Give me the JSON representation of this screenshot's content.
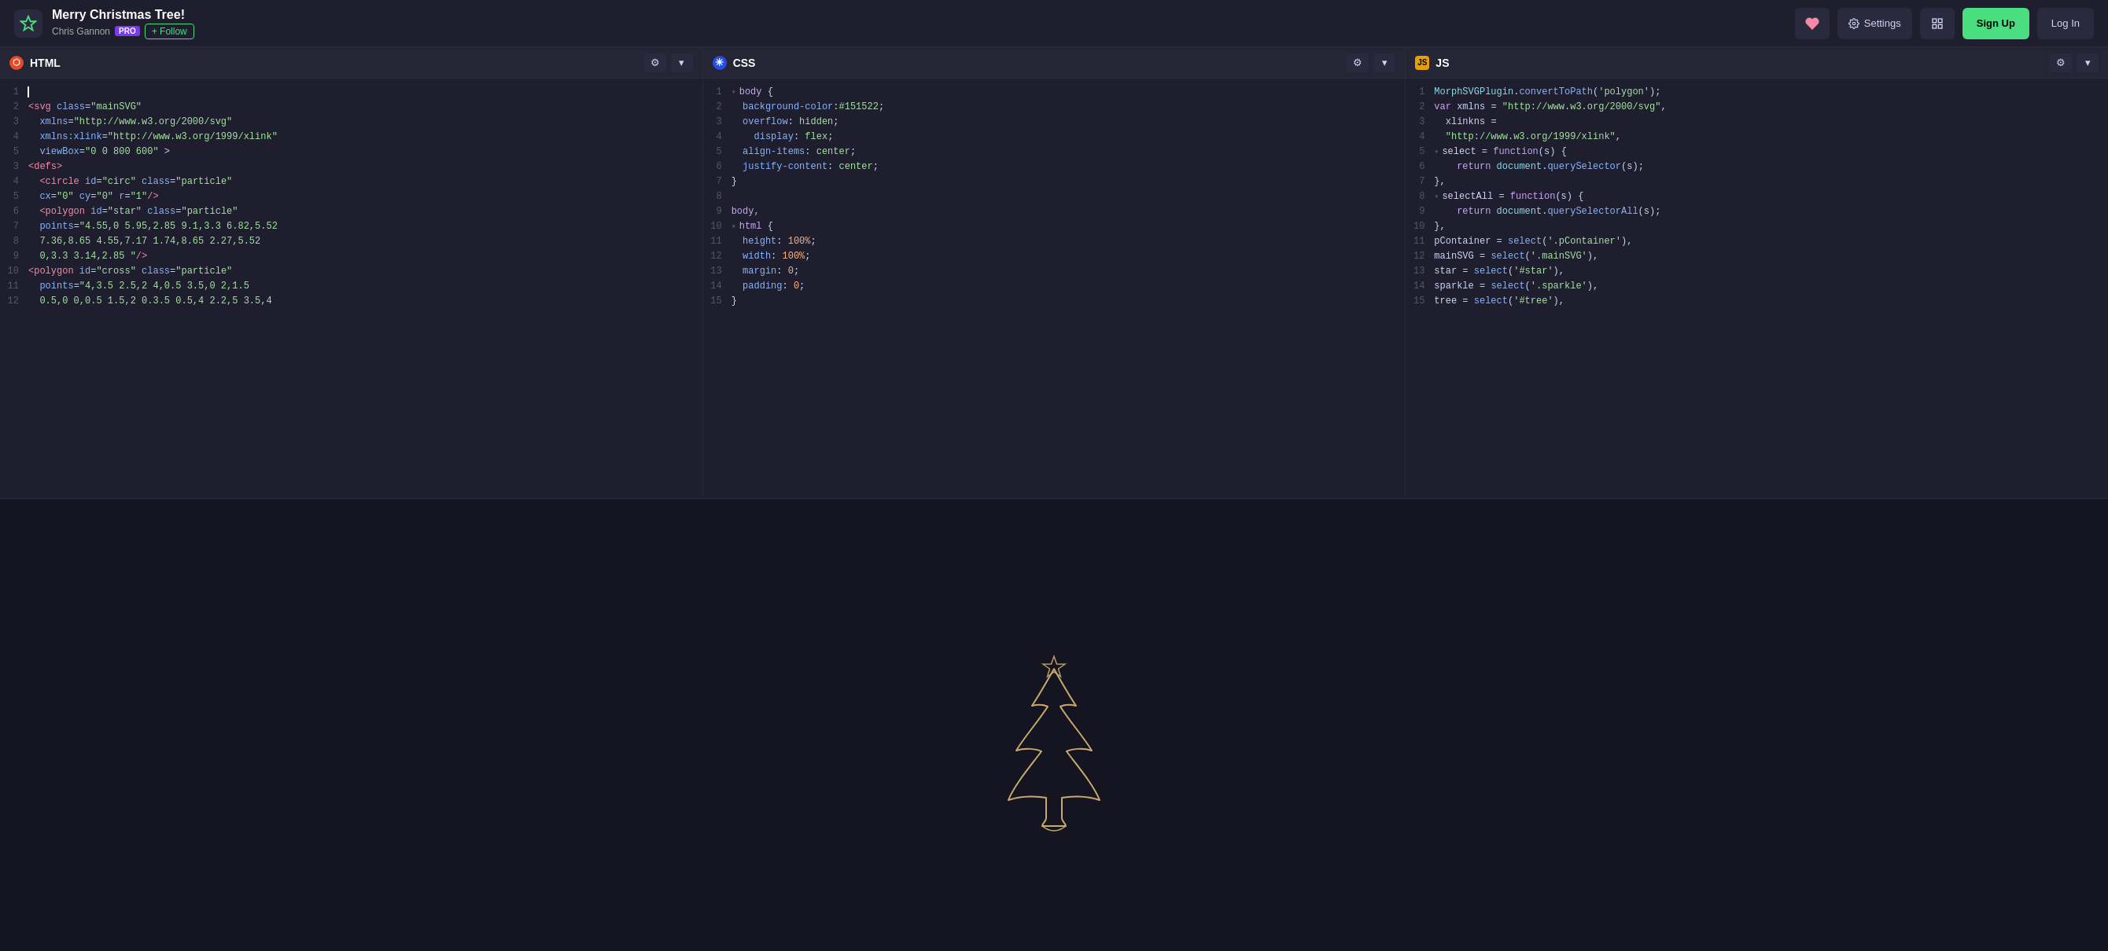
{
  "topbar": {
    "title": "Merry Christmas Tree!",
    "author": "Chris Gannon",
    "pro_label": "PRO",
    "follow_label": "+ Follow",
    "settings_label": "Settings",
    "signup_label": "Sign Up",
    "login_label": "Log In"
  },
  "panels": {
    "html": {
      "title": "HTML",
      "gear_label": "⚙",
      "expand_label": "▾"
    },
    "css": {
      "title": "CSS",
      "gear_label": "⚙",
      "expand_label": "▾"
    },
    "js": {
      "title": "JS",
      "gear_label": "⚙",
      "expand_label": "▾"
    }
  },
  "html_lines": [
    "",
    "<svg class=\"mainSVG\"",
    "  xmlns=\"http://www.w3.org/2000/svg\"",
    "  xmlns:xlink=\"http://www.w3.org/1999/xlink\"",
    "  viewBox=\"0 0 800 600\" >",
    "<defs>",
    "  <circle id=\"circ\" class=\"particle\"",
    "  cx=\"0\" cy=\"0\" r=\"1\"/>",
    "  <polygon id=\"star\" class=\"particle\"",
    "  points=\"4.55,0 5.95,2.85 9.1,3.3 6.82,5.52",
    "  7.36,8.65 4.55,7.17 1.74,8.65 2.27,5.52",
    "  0,3.3 3.14,2.85 \"/>",
    "<polygon id=\"cross\" class=\"particle\"",
    "  points=\"4,3.5 2.5,2 4,0.5 3.5,0 2,1.5",
    "  0.5,0 0,0.5 1.5,2 0.3.5 0.5,4 2.2,5 3.5,4"
  ],
  "css_lines": [
    "body {",
    "  background-color:#151522;",
    "  overflow: hidden;",
    "    display: flex;",
    "  align-items: center;",
    "  justify-content: center;",
    "}",
    "",
    "body,",
    "html {",
    "  height: 100%;",
    "  width: 100%;",
    "  margin: 0;",
    "  padding: 0;",
    "}"
  ],
  "js_lines": [
    "MorphSVGPlugin.convertToPath('polygon');",
    "var xmlns = \"http://www.w3.org/2000/svg\",",
    "  xlinkns =",
    "  \"http://www.w3.org/1999/xlink\",",
    "select = function(s) {",
    "    return document.querySelector(s);",
    "},",
    "selectAll = function(s) {",
    "    return document.querySelectorAll(s);",
    "},",
    "pContainer = select('.pContainer'),",
    "mainSVG = select('.mainSVG'),",
    "star = select('#star'),",
    "sparkle = select('.sparkle'),",
    "tree = select('#tree'),"
  ]
}
